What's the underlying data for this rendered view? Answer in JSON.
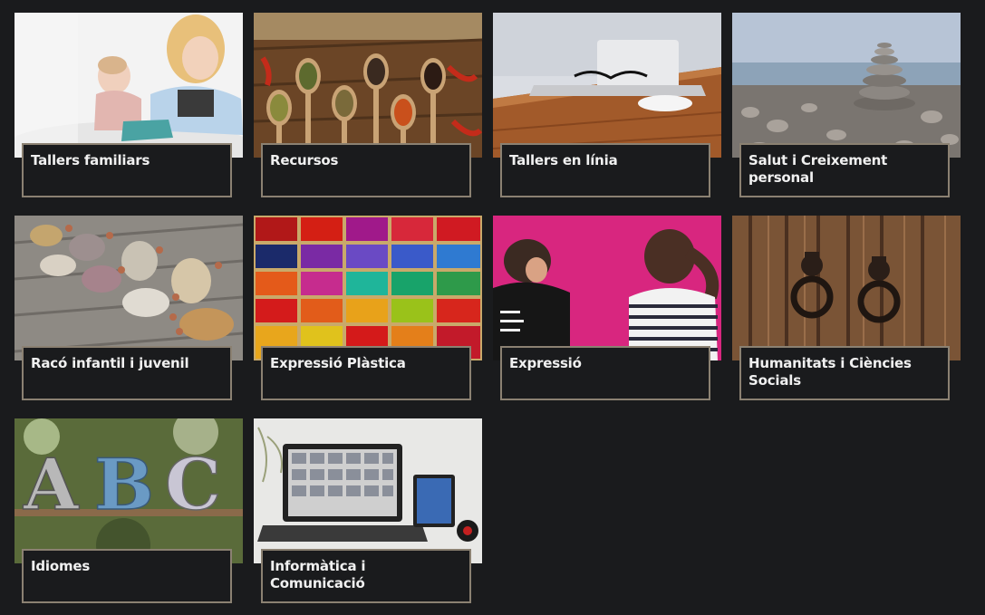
{
  "categories": [
    {
      "label": "Tallers familiars",
      "image": "family-reading-photo"
    },
    {
      "label": "Recursos",
      "image": "spice-spoons-photo"
    },
    {
      "label": "Tallers en línia",
      "image": "laptop-desk-photo"
    },
    {
      "label": "Salut i Creixement personal",
      "image": "stacked-stones-photo"
    },
    {
      "label": "Racó infantil i juvenil",
      "image": "pebble-footprints-photo"
    },
    {
      "label": "Expressió Plàstica",
      "image": "pigment-grid-photo"
    },
    {
      "label": "Expressió",
      "image": "dancers-pink-wall-photo"
    },
    {
      "label": "Humanitats i Ciències Socials",
      "image": "wooden-door-knockers-photo"
    },
    {
      "label": "Idiomes",
      "image": "abc-letters-photo"
    },
    {
      "label": "Informàtica i Comunicació",
      "image": "laptop-tablet-photo"
    }
  ],
  "colors": {
    "background": "#1a1b1d",
    "caption_border": "#8b8172",
    "caption_text": "#f0f0f0"
  }
}
